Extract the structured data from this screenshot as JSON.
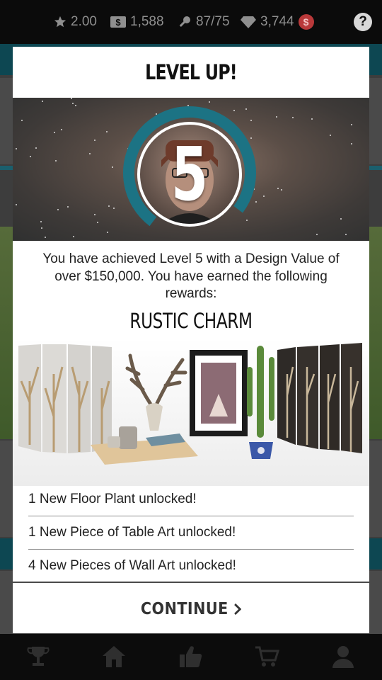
{
  "topbar": {
    "rating": "2.00",
    "cash": "1,588",
    "keys": "87/75",
    "diamonds": "3,744",
    "coin_symbol": "$",
    "help_label": "?"
  },
  "modal": {
    "title": "LEVEL UP!",
    "level_number": "5",
    "message": "You have achieved Level 5 with a Design Value of over $150,000.  You have earned the following rewards:",
    "reward_set": "RUSTIC CHARM",
    "rewards": [
      "1 New Floor Plant unlocked!",
      "1 New Piece of Table Art unlocked!",
      "4 New Pieces of Wall Art unlocked!"
    ],
    "continue_label": "CONTINUE"
  },
  "colors": {
    "ring": "#1c7384",
    "ring_track": "#0f4a55",
    "coin": "#b9393a",
    "topbar": "#0b0b0b"
  },
  "icons": [
    "star-icon",
    "cash-icon",
    "key-icon",
    "diamond-icon",
    "coin-icon",
    "help-icon",
    "trophy-icon",
    "home-icon",
    "thumbs-up-icon",
    "cart-icon",
    "profile-icon",
    "chevron-right-icon"
  ]
}
